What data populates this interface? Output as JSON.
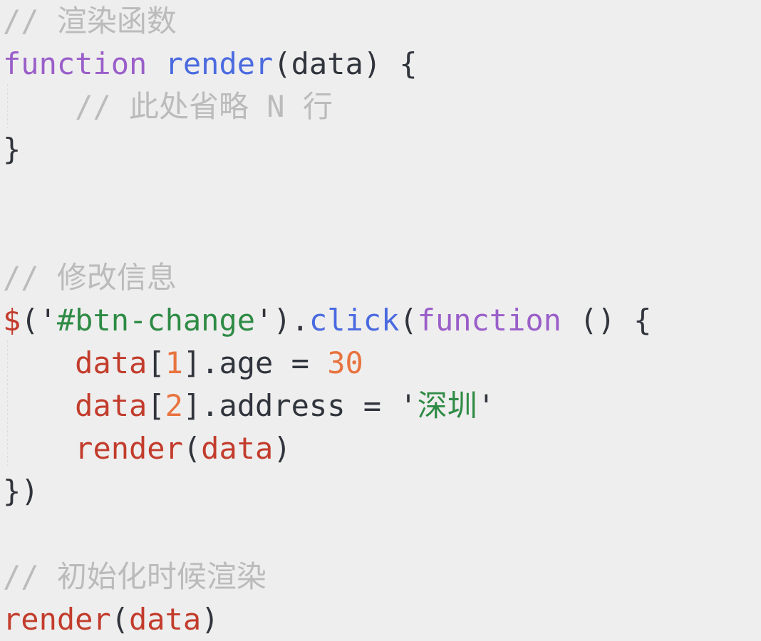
{
  "editor": {
    "background_color": "#efeeee",
    "language": "javascript",
    "colors": {
      "comment": "#bbbbbb",
      "keyword": "#9a5fc9",
      "function_definition": "#4a6ae0",
      "method": "#4a6ae0",
      "identifier": "#c23c2c",
      "number": "#e8733f",
      "string": "#2e8b45",
      "punctuation": "#30343c"
    }
  },
  "code": {
    "lines": [
      {
        "index": 0,
        "indent": "",
        "tokens": [
          {
            "type": "comment",
            "text": "// 渲染函数"
          }
        ]
      },
      {
        "index": 1,
        "indent": "",
        "tokens": [
          {
            "type": "keyword",
            "text": "function"
          },
          {
            "type": "plain",
            "text": " "
          },
          {
            "type": "funcdef",
            "text": "render"
          },
          {
            "type": "punct",
            "text": "("
          },
          {
            "type": "plain",
            "text": "data"
          },
          {
            "type": "punct",
            "text": ") {"
          }
        ]
      },
      {
        "index": 2,
        "indent": "    ",
        "tokens": [
          {
            "type": "comment",
            "text": "// 此处省略 N 行"
          }
        ]
      },
      {
        "index": 3,
        "indent": "",
        "tokens": [
          {
            "type": "punct",
            "text": "}"
          }
        ]
      },
      {
        "index": 4,
        "indent": "",
        "tokens": []
      },
      {
        "index": 5,
        "indent": "",
        "tokens": []
      },
      {
        "index": 6,
        "indent": "",
        "tokens": [
          {
            "type": "comment",
            "text": "// 修改信息"
          }
        ]
      },
      {
        "index": 7,
        "indent": "",
        "tokens": [
          {
            "type": "name",
            "text": "$"
          },
          {
            "type": "punct",
            "text": "("
          },
          {
            "type": "punct",
            "text": "'"
          },
          {
            "type": "string",
            "text": "#btn-change"
          },
          {
            "type": "punct",
            "text": "'"
          },
          {
            "type": "punct",
            "text": ")."
          },
          {
            "type": "method",
            "text": "click"
          },
          {
            "type": "punct",
            "text": "("
          },
          {
            "type": "keyword",
            "text": "function"
          },
          {
            "type": "plain",
            "text": " "
          },
          {
            "type": "punct",
            "text": "() {"
          }
        ]
      },
      {
        "index": 8,
        "indent": "    ",
        "tokens": [
          {
            "type": "name",
            "text": "data"
          },
          {
            "type": "punct",
            "text": "["
          },
          {
            "type": "number",
            "text": "1"
          },
          {
            "type": "punct",
            "text": "]."
          },
          {
            "type": "plain",
            "text": "age"
          },
          {
            "type": "plain",
            "text": " "
          },
          {
            "type": "punct",
            "text": "="
          },
          {
            "type": "plain",
            "text": " "
          },
          {
            "type": "number",
            "text": "30"
          }
        ]
      },
      {
        "index": 9,
        "indent": "    ",
        "tokens": [
          {
            "type": "name",
            "text": "data"
          },
          {
            "type": "punct",
            "text": "["
          },
          {
            "type": "number",
            "text": "2"
          },
          {
            "type": "punct",
            "text": "]."
          },
          {
            "type": "plain",
            "text": "address"
          },
          {
            "type": "plain",
            "text": " "
          },
          {
            "type": "punct",
            "text": "="
          },
          {
            "type": "plain",
            "text": " "
          },
          {
            "type": "punct",
            "text": "'"
          },
          {
            "type": "string",
            "text": "深圳"
          },
          {
            "type": "punct",
            "text": "'"
          }
        ]
      },
      {
        "index": 10,
        "indent": "    ",
        "tokens": [
          {
            "type": "name",
            "text": "render"
          },
          {
            "type": "punct",
            "text": "("
          },
          {
            "type": "name",
            "text": "data"
          },
          {
            "type": "punct",
            "text": ")"
          }
        ]
      },
      {
        "index": 11,
        "indent": "",
        "tokens": [
          {
            "type": "punct",
            "text": "})"
          }
        ]
      },
      {
        "index": 12,
        "indent": "",
        "tokens": []
      },
      {
        "index": 13,
        "indent": "",
        "tokens": [
          {
            "type": "comment",
            "text": "// 初始化时候渲染"
          }
        ]
      },
      {
        "index": 14,
        "indent": "",
        "tokens": [
          {
            "type": "name",
            "text": "render"
          },
          {
            "type": "punct",
            "text": "("
          },
          {
            "type": "name",
            "text": "data"
          },
          {
            "type": "punct",
            "text": ")"
          }
        ]
      }
    ]
  }
}
